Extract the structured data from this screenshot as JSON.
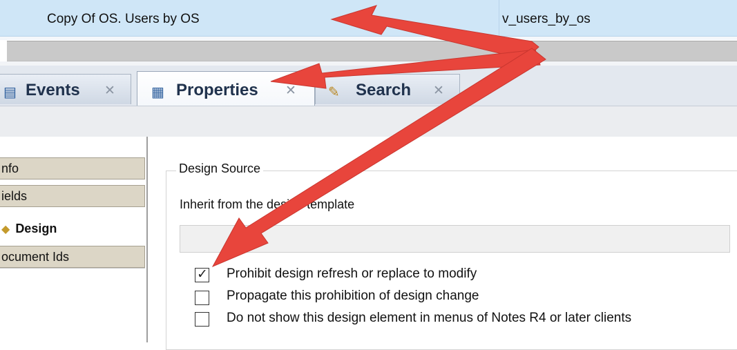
{
  "top_row": {
    "name": "Copy Of OS. Users by OS",
    "alias": "v_users_by_os"
  },
  "tabs": [
    {
      "label": "Events",
      "icon": "events-icon",
      "close": "✕"
    },
    {
      "label": "Properties",
      "icon": "properties-icon",
      "close": "✕"
    },
    {
      "label": "Search",
      "icon": "search-icon",
      "close": "✕"
    }
  ],
  "nav": {
    "items": [
      {
        "label": "nfo"
      },
      {
        "label": "ields"
      },
      {
        "label": "Design"
      },
      {
        "label": "ocument Ids"
      }
    ]
  },
  "design_source": {
    "title": "Design Source",
    "inherit_label": "Inherit from the design template",
    "inherit_value": "",
    "options": [
      {
        "label": "Prohibit design refresh or replace to modify",
        "checked": true
      },
      {
        "label": "Propagate this prohibition of design change",
        "checked": false
      },
      {
        "label": "Do not show this design element in menus of Notes R4 or later clients",
        "checked": false
      }
    ]
  },
  "colors": {
    "arrow": "#e8453c",
    "selection": "#cfe6f7"
  }
}
